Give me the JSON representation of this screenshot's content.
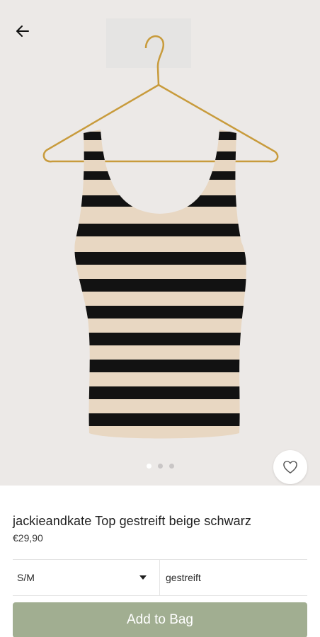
{
  "header": {
    "back_icon": "arrow-left-icon"
  },
  "gallery": {
    "image_count": 3,
    "active_index": 0,
    "favorite_icon": "heart-outline-icon"
  },
  "product": {
    "title": "jackieandkate Top gestreift beige schwarz",
    "price": "€29,90"
  },
  "options": {
    "size": {
      "selected": "S/M",
      "icon": "caret-down-icon"
    },
    "variant": {
      "selected": "gestreift"
    }
  },
  "actions": {
    "add_to_bag": "Add to Bag"
  },
  "colors": {
    "button": "#a1ae91",
    "background": "#ece9e7"
  }
}
